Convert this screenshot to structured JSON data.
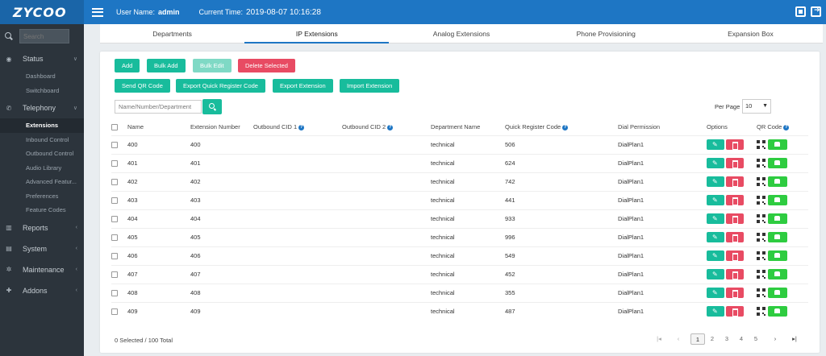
{
  "header": {
    "logo": "ZYCOO",
    "user_label": "User Name:",
    "user_name": "admin",
    "time_label": "Current Time:",
    "current_time": "2019-08-07 10:16:28"
  },
  "sidebar": {
    "search_placeholder": "Search",
    "sections": {
      "status": "Status",
      "telephony": "Telephony",
      "reports": "Reports",
      "system": "System",
      "maintenance": "Maintenance",
      "addons": "Addons"
    },
    "status_items": [
      "Dashboard",
      "Switchboard"
    ],
    "telephony_items": [
      "Extensions",
      "Inbound Control",
      "Outbound Control",
      "Audio Library",
      "Advanced Featur...",
      "Preferences",
      "Feature Codes"
    ]
  },
  "tabs": [
    "Departments",
    "IP Extensions",
    "Analog Extensions",
    "Phone Provisioning",
    "Expansion Box"
  ],
  "actions": {
    "add": "Add",
    "bulk_add": "Bulk Add",
    "bulk_edit": "Bulk Edit",
    "delete_selected": "Delete Selected",
    "send_qr": "Send QR Code",
    "export_quick": "Export Quick Register Code",
    "export_ext": "Export Extension",
    "import_ext": "Import Extension"
  },
  "filter": {
    "placeholder": "Name/Number/Department",
    "per_page_label": "Per Page",
    "per_page_value": "10"
  },
  "table": {
    "columns": [
      "Name",
      "Extension Number",
      "Outbound CID 1",
      "Outbound CID 2",
      "Department Name",
      "Quick Register Code",
      "Dial Permission",
      "Options",
      "QR Code"
    ],
    "rows": [
      {
        "name": "400",
        "ext": "400",
        "cid1": "",
        "cid2": "",
        "dept": "technical",
        "code": "506",
        "perm": "DialPlan1"
      },
      {
        "name": "401",
        "ext": "401",
        "cid1": "",
        "cid2": "",
        "dept": "technical",
        "code": "624",
        "perm": "DialPlan1"
      },
      {
        "name": "402",
        "ext": "402",
        "cid1": "",
        "cid2": "",
        "dept": "technical",
        "code": "742",
        "perm": "DialPlan1"
      },
      {
        "name": "403",
        "ext": "403",
        "cid1": "",
        "cid2": "",
        "dept": "technical",
        "code": "441",
        "perm": "DialPlan1"
      },
      {
        "name": "404",
        "ext": "404",
        "cid1": "",
        "cid2": "",
        "dept": "technical",
        "code": "933",
        "perm": "DialPlan1"
      },
      {
        "name": "405",
        "ext": "405",
        "cid1": "",
        "cid2": "",
        "dept": "technical",
        "code": "996",
        "perm": "DialPlan1"
      },
      {
        "name": "406",
        "ext": "406",
        "cid1": "",
        "cid2": "",
        "dept": "technical",
        "code": "549",
        "perm": "DialPlan1"
      },
      {
        "name": "407",
        "ext": "407",
        "cid1": "",
        "cid2": "",
        "dept": "technical",
        "code": "452",
        "perm": "DialPlan1"
      },
      {
        "name": "408",
        "ext": "408",
        "cid1": "",
        "cid2": "",
        "dept": "technical",
        "code": "355",
        "perm": "DialPlan1"
      },
      {
        "name": "409",
        "ext": "409",
        "cid1": "",
        "cid2": "",
        "dept": "technical",
        "code": "487",
        "perm": "DialPlan1"
      }
    ]
  },
  "footer": {
    "summary": "0 Selected / 100 Total",
    "pages": [
      "1",
      "2",
      "3",
      "4",
      "5"
    ],
    "current_page": "1"
  },
  "colors": {
    "header_blue": "#1e76c4",
    "sidebar_bg": "#2c343c",
    "green": "#18bc9c",
    "red": "#e84b63"
  }
}
